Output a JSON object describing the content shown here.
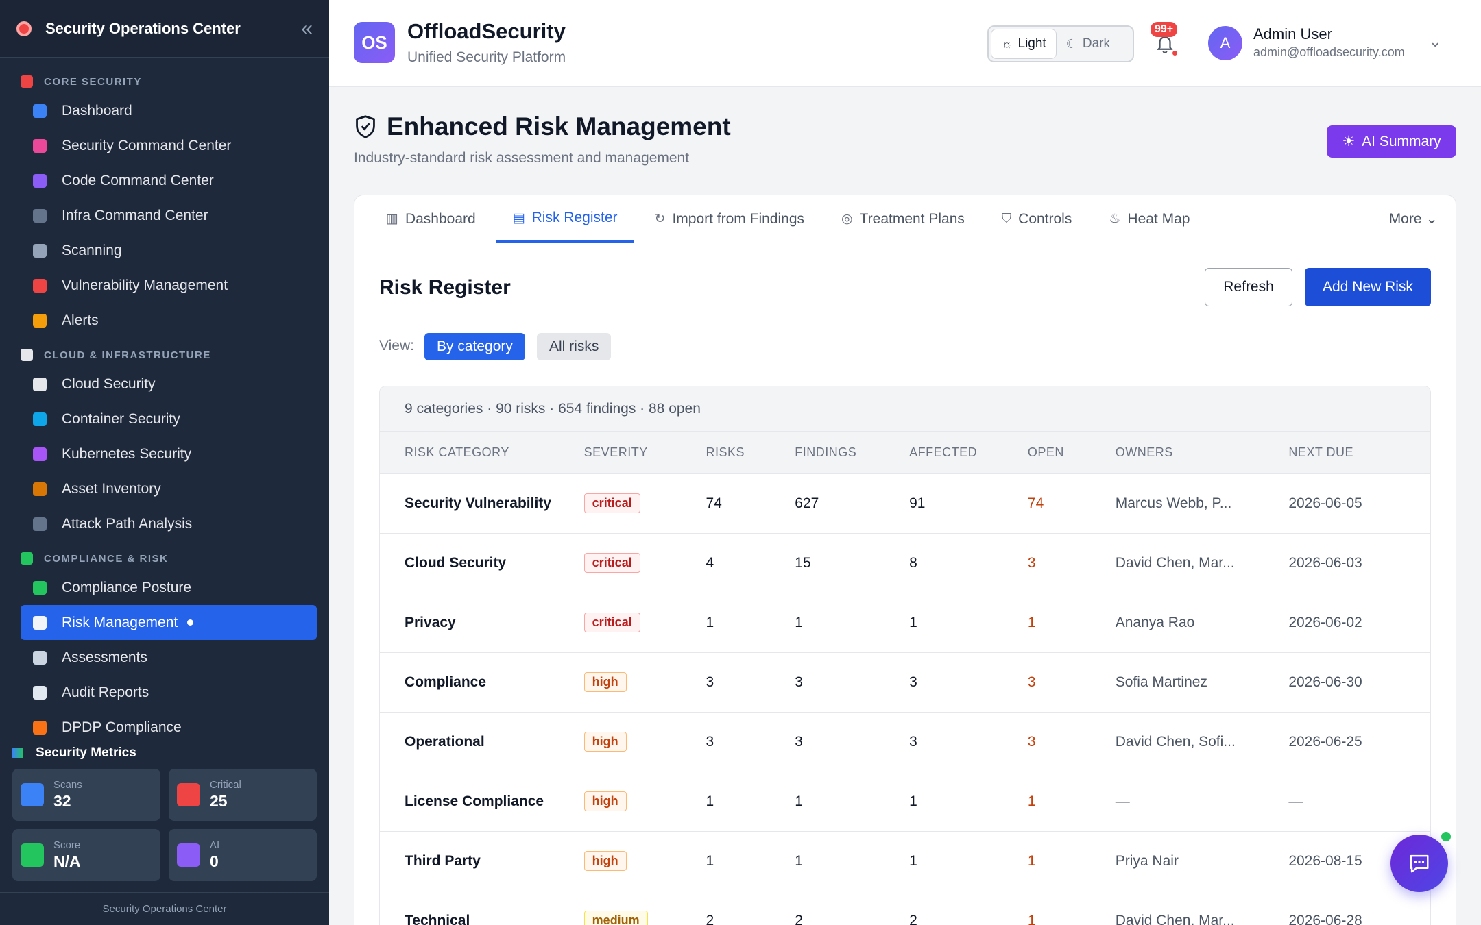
{
  "sidebar": {
    "title": "Security Operations Center",
    "sections": [
      {
        "label": "CORE SECURITY",
        "icon": "shield-icon",
        "color": "#ef4444",
        "items": [
          {
            "label": "Dashboard",
            "icon": "bar-chart-icon",
            "color": "#3b82f6"
          },
          {
            "label": "Security Command Center",
            "icon": "brain-icon",
            "color": "#ec4899"
          },
          {
            "label": "Code Command Center",
            "icon": "dna-icon",
            "color": "#8b5cf6"
          },
          {
            "label": "Infra Command Center",
            "icon": "monitor-icon",
            "color": "#64748b"
          },
          {
            "label": "Scanning",
            "icon": "magnifier-icon",
            "color": "#94a3b8"
          },
          {
            "label": "Vulnerability Management",
            "icon": "shield-icon",
            "color": "#ef4444"
          },
          {
            "label": "Alerts",
            "icon": "bell-icon",
            "color": "#f59e0b"
          }
        ]
      },
      {
        "label": "CLOUD & INFRASTRUCTURE",
        "icon": "cloud-icon",
        "color": "#e5e7eb",
        "items": [
          {
            "label": "Cloud Security",
            "icon": "cloud-icon",
            "color": "#e5e7eb"
          },
          {
            "label": "Container Security",
            "icon": "whale-icon",
            "color": "#0ea5e9"
          },
          {
            "label": "Kubernetes Security",
            "icon": "atom-icon",
            "color": "#a855f7"
          },
          {
            "label": "Asset Inventory",
            "icon": "package-icon",
            "color": "#d97706"
          },
          {
            "label": "Attack Path Analysis",
            "icon": "molecule-icon",
            "color": "#64748b"
          }
        ]
      },
      {
        "label": "COMPLIANCE & RISK",
        "icon": "check-box-icon",
        "color": "#22c55e",
        "items": [
          {
            "label": "Compliance Posture",
            "icon": "check-box-icon",
            "color": "#22c55e"
          },
          {
            "label": "Risk Management",
            "icon": "trend-chart-icon",
            "color": "#f1f5f9",
            "active": true
          },
          {
            "label": "Assessments",
            "icon": "clipboard-icon",
            "color": "#cbd5e1"
          },
          {
            "label": "Audit Reports",
            "icon": "document-icon",
            "color": "#e2e8f0"
          },
          {
            "label": "DPDP Compliance",
            "icon": "india-flag-icon",
            "color": "#f97316"
          }
        ]
      }
    ],
    "metrics_title": "Security Metrics",
    "metrics": [
      {
        "label": "Scans",
        "value": "32",
        "icon": "magnifier-icon",
        "color": "#3b82f6"
      },
      {
        "label": "Critical",
        "value": "25",
        "icon": "warning-icon",
        "color": "#ef4444"
      },
      {
        "label": "Score",
        "value": "N/A",
        "icon": "shield-icon",
        "color": "#22c55e"
      },
      {
        "label": "AI",
        "value": "0",
        "icon": "robot-icon",
        "color": "#8b5cf6"
      }
    ],
    "footer": "Security Operations Center"
  },
  "topbar": {
    "logo": "OS",
    "brand": "OffloadSecurity",
    "tagline": "Unified Security Platform",
    "theme_light": "Light",
    "theme_dark": "Dark",
    "notif_badge": "99+",
    "avatar": "A",
    "user_name": "Admin User",
    "user_email": "admin@offloadsecurity.com"
  },
  "page": {
    "title": "Enhanced Risk Management",
    "subtitle": "Industry-standard risk assessment and management",
    "ai_button": "AI Summary"
  },
  "tabs": [
    {
      "label": "Dashboard",
      "icon": "bar-chart-icon"
    },
    {
      "label": "Risk Register",
      "icon": "clipboard-icon",
      "active": true
    },
    {
      "label": "Import from Findings",
      "icon": "refresh-icon"
    },
    {
      "label": "Treatment Plans",
      "icon": "target-icon"
    },
    {
      "label": "Controls",
      "icon": "shield-outline-icon"
    },
    {
      "label": "Heat Map",
      "icon": "flame-icon"
    }
  ],
  "tab_more": "More",
  "register": {
    "title": "Risk Register",
    "refresh": "Refresh",
    "add": "Add New Risk",
    "view_label": "View:",
    "view_by_category": "By category",
    "view_all": "All risks",
    "summary": "9 categories · 90 risks · 654 findings · 88 open",
    "columns": [
      "RISK CATEGORY",
      "SEVERITY",
      "RISKS",
      "FINDINGS",
      "AFFECTED",
      "OPEN",
      "OWNERS",
      "NEXT DUE"
    ],
    "rows": [
      {
        "category": "Security Vulnerability",
        "severity": "critical",
        "risks": "74",
        "findings": "627",
        "affected": "91",
        "open": "74",
        "owners": "Marcus Webb, P...",
        "due": "2026-06-05"
      },
      {
        "category": "Cloud Security",
        "severity": "critical",
        "risks": "4",
        "findings": "15",
        "affected": "8",
        "open": "3",
        "owners": "David Chen, Mar...",
        "due": "2026-06-03"
      },
      {
        "category": "Privacy",
        "severity": "critical",
        "risks": "1",
        "findings": "1",
        "affected": "1",
        "open": "1",
        "owners": "Ananya Rao",
        "due": "2026-06-02"
      },
      {
        "category": "Compliance",
        "severity": "high",
        "risks": "3",
        "findings": "3",
        "affected": "3",
        "open": "3",
        "owners": "Sofia Martinez",
        "due": "2026-06-30"
      },
      {
        "category": "Operational",
        "severity": "high",
        "risks": "3",
        "findings": "3",
        "affected": "3",
        "open": "3",
        "owners": "David Chen, Sofi...",
        "due": "2026-06-25"
      },
      {
        "category": "License Compliance",
        "severity": "high",
        "risks": "1",
        "findings": "1",
        "affected": "1",
        "open": "1",
        "owners": "—",
        "due": "—"
      },
      {
        "category": "Third Party",
        "severity": "high",
        "risks": "1",
        "findings": "1",
        "affected": "1",
        "open": "1",
        "owners": "Priya Nair",
        "due": "2026-08-15"
      },
      {
        "category": "Technical",
        "severity": "medium",
        "risks": "2",
        "findings": "2",
        "affected": "2",
        "open": "1",
        "owners": "David Chen, Mar...",
        "due": "2026-06-28"
      }
    ]
  }
}
